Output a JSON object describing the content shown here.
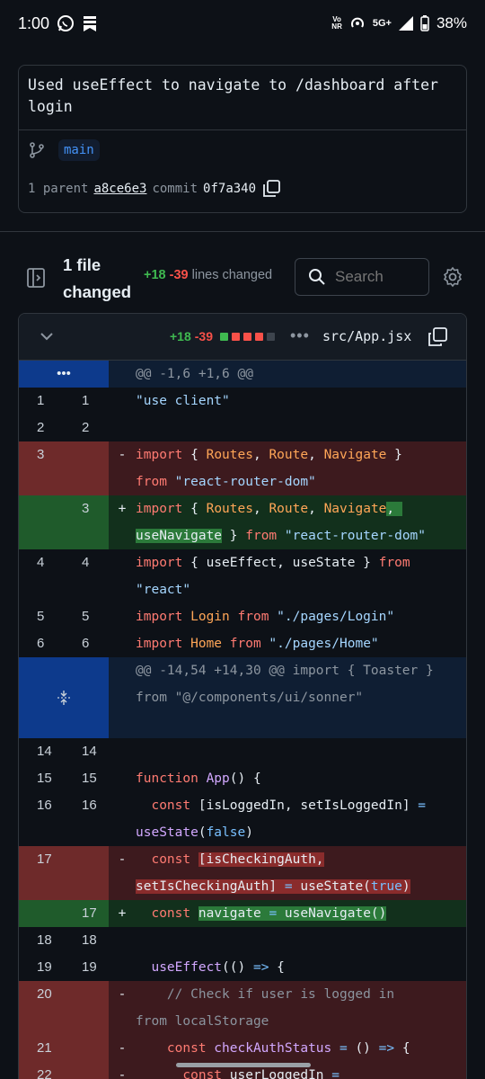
{
  "status_bar": {
    "time": "1:00",
    "net_top": "Vo",
    "net_bottom": "NR",
    "network": "5G+",
    "battery": "38%"
  },
  "commit": {
    "message": "Used useEffect to navigate to /dashboard after login",
    "branch": "main",
    "parent_label": "1 parent",
    "parent_sha": "a8ce6e3",
    "commit_label": "commit",
    "commit_sha": "0f7a340"
  },
  "files_changed": {
    "title": "1 file changed",
    "additions": "+18",
    "deletions": "-39",
    "lines_label": "lines changed",
    "search_placeholder": "Search"
  },
  "diff_file": {
    "additions": "+18",
    "deletions": "-39",
    "more": "•••",
    "filename": "src/App.jsx"
  },
  "diff": {
    "hunk1": {
      "header": "@@ -1,6 +1,6 @@"
    },
    "hunk2": {
      "header": "@@ -14,54 +14,30 @@ import { Toaster } from \"@/components/ui/sonner\""
    },
    "lines": [
      {
        "o": "1",
        "n": "1"
      },
      {
        "o": "2",
        "n": "2"
      },
      {
        "o": "3",
        "n": ""
      },
      {
        "o": "",
        "n": "3"
      },
      {
        "o": "4",
        "n": "4"
      },
      {
        "o": "5",
        "n": "5"
      },
      {
        "o": "6",
        "n": "6"
      },
      {
        "o": "14",
        "n": "14"
      },
      {
        "o": "15",
        "n": "15"
      },
      {
        "o": "16",
        "n": "16"
      },
      {
        "o": "17",
        "n": ""
      },
      {
        "o": "",
        "n": "17"
      },
      {
        "o": "18",
        "n": "18"
      },
      {
        "o": "19",
        "n": "19"
      },
      {
        "o": "20",
        "n": ""
      },
      {
        "o": "21",
        "n": ""
      },
      {
        "o": "22",
        "n": ""
      }
    ],
    "code": {
      "l1": "\"use client\"",
      "l3a": "import",
      "l3b": " { ",
      "l3c": "Routes",
      "l3d": ", ",
      "l3e": "Route",
      "l3f": ", ",
      "l3g": "Navigate",
      "l3h": " }",
      "l3i": "from",
      "l3j": " \"react-router-dom\"",
      "l3n_a": "import",
      "l3n_b": " { ",
      "l3n_c": "Routes",
      "l3n_d": ", ",
      "l3n_e": "Route",
      "l3n_f": ", ",
      "l3n_g": "Navigate",
      "l3n_h": ", ",
      "l3n_i": "useNavigate",
      "l3n_j": " } ",
      "l3n_k": "from",
      "l3n_l": " \"react-router-dom\"",
      "l4a": "import",
      "l4b": " { useEffect, useState } ",
      "l4c": "from",
      "l4d": "\"react\"",
      "l5a": "import",
      "l5b": " Login ",
      "l5c": "from",
      "l5d": " \"./pages/Login\"",
      "l6a": "import",
      "l6b": " Home ",
      "l6c": "from",
      "l6d": " \"./pages/Home\"",
      "l15a": "function",
      "l15b": " App",
      "l15c": "() {",
      "l16a": "  const",
      "l16b": " [isLoggedIn, setIsLoggedIn] ",
      "l16c": "=",
      "l16d": "useState",
      "l16e": "(",
      "l16f": "false",
      "l16g": ")",
      "l17a": "  const",
      "l17b": " ",
      "l17c": "[isCheckingAuth,",
      "l17d": "setIsCheckingAuth] ",
      "l17e": "=",
      "l17f": " useState(",
      "l17g": "true",
      "l17h": ")",
      "l17n_a": "  const",
      "l17n_b": " ",
      "l17n_c": "navigate ",
      "l17n_d": "=",
      "l17n_e": " useNavigate()",
      "l19a": "  useEffect",
      "l19b": "(() ",
      "l19c": "=>",
      "l19d": " {",
      "l20a": "    // Check if user is logged in",
      "l20b": "from localStorage",
      "l21a": "    const",
      "l21b": " checkAuthStatus ",
      "l21c": "=",
      "l21d": " () ",
      "l21e": "=>",
      "l21f": " {",
      "l22a": "      const",
      "l22b": " userLoggedIn ",
      "l22c": "="
    },
    "sign_del": "-",
    "sign_add": "+"
  },
  "colors": {
    "background": "#0d1117",
    "accent": "#4493f8",
    "add": "#3fb950",
    "del": "#f85149"
  }
}
